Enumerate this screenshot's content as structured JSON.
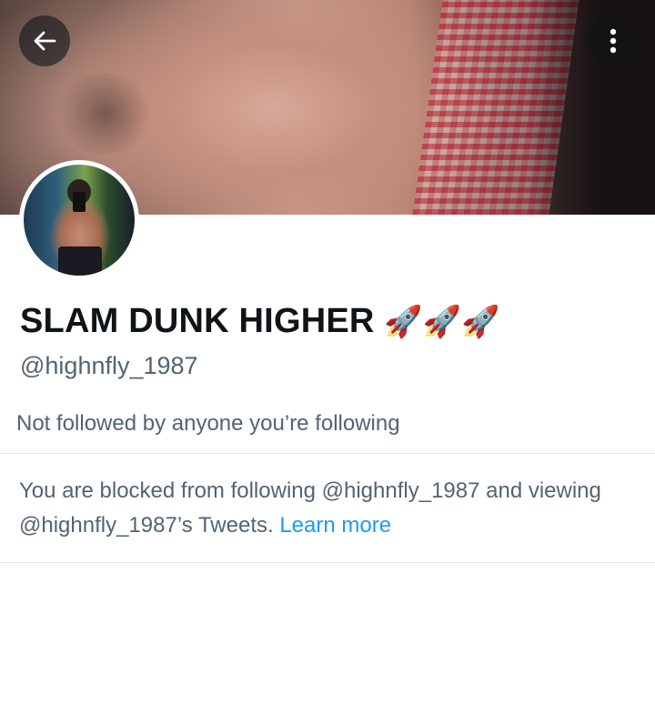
{
  "header": {
    "back_icon": "arrow-left-icon",
    "more_icon": "vertical-dots-icon"
  },
  "profile": {
    "display_name": "SLAM DUNK HIGHER",
    "name_emoji": "🚀🚀🚀",
    "handle": "@highnfly_1987",
    "followers_note": "Not followed by anyone you’re following"
  },
  "blocked": {
    "message": "You are blocked from following @highnfly_1987 and viewing @highnfly_1987’s Tweets.",
    "link_label": "Learn more"
  },
  "colors": {
    "link": "#1d9bf0",
    "secondary_text": "#536471",
    "primary_text": "#0f1419"
  }
}
